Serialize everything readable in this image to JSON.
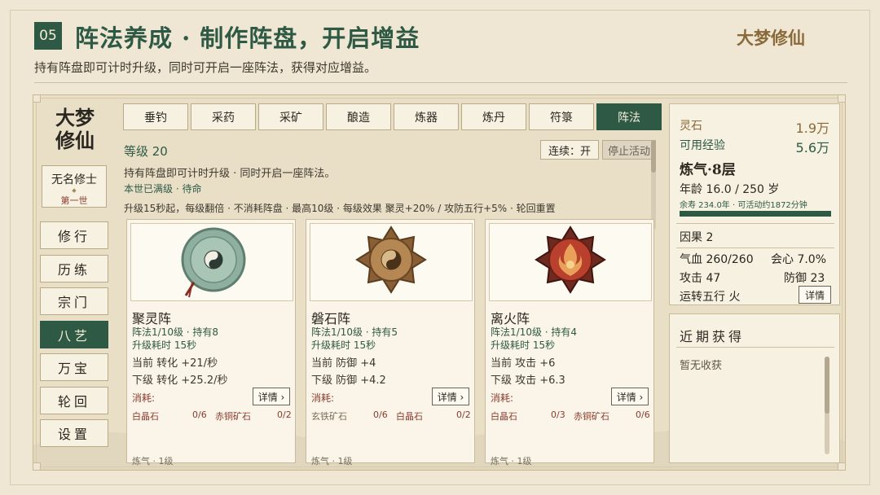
{
  "header": {
    "number": "05",
    "title": "阵法养成 · 制作阵盘，开启增益",
    "brand": "大梦修仙",
    "subtitle": "持有阵盘即可计时升级，同时可开启一座阵法，获得对应增益。"
  },
  "sidebar": {
    "logo_line1": "大梦",
    "logo_line2": "修仙",
    "player_name": "无名修士",
    "player_gen": "第一世",
    "items": [
      {
        "label": "修行"
      },
      {
        "label": "历练"
      },
      {
        "label": "宗门"
      },
      {
        "label": "八艺",
        "active": true
      },
      {
        "label": "万宝"
      },
      {
        "label": "轮回"
      },
      {
        "label": "设置"
      }
    ]
  },
  "tabs": [
    "垂钓",
    "采药",
    "采矿",
    "酿造",
    "炼器",
    "炼丹",
    "符箓",
    "阵法"
  ],
  "active_tab": "阵法",
  "main": {
    "level": "等级 20",
    "continuous": "连续：开",
    "stop": "停止活动",
    "desc": "持有阵盘即可计时升级 · 同时开启一座阵法。",
    "maxed": "本世已满级 · 待命",
    "rule": "升级15秒起，每级翻倍 · 不消耗阵盘 · 最高10级 · 每级效果 聚灵+20% / 攻防五行+5% · 轮回重置"
  },
  "cards": [
    {
      "name": "聚灵阵",
      "level": "阵法1/10级 · 持有8",
      "time": "升级耗时 15秒",
      "current": "当前 转化 +21/秒",
      "next": "下级 转化 +25.2/秒",
      "cost_label": "消耗:",
      "detail": "详情 ›",
      "mat1": "白晶石",
      "mat1_qty": "0/6",
      "mat2": "赤铜矿石",
      "mat2_qty": "0/2",
      "foot": "炼气 · 1级",
      "icon": "jade-disc-icon"
    },
    {
      "name": "磐石阵",
      "level": "阵法1/10级 · 持有5",
      "time": "升级耗时 15秒",
      "current": "当前 防御 +4",
      "next": "下级 防御 +4.2",
      "cost_label": "消耗:",
      "detail": "详情 ›",
      "mat1": "玄铁矿石",
      "mat1_qty": "0/6",
      "mat2": "白晶石",
      "mat2_qty": "0/2",
      "foot": "炼气 · 1级",
      "icon": "bronze-bagua-icon"
    },
    {
      "name": "离火阵",
      "level": "阵法1/10级 · 持有4",
      "time": "升级耗时 15秒",
      "current": "当前 攻击 +6",
      "next": "下级 攻击 +6.3",
      "cost_label": "消耗:",
      "detail": "详情 ›",
      "mat1": "白晶石",
      "mat1_qty": "0/3",
      "mat2": "赤铜矿石",
      "mat2_qty": "0/6",
      "foot": "炼气 · 1级",
      "icon": "fire-disc-icon"
    }
  ],
  "stats": {
    "stone_label": "灵石",
    "stone": "1.9万",
    "exp_label": "可用经验",
    "exp": "5.6万",
    "realm": "炼气·8层",
    "age": "年龄 16.0 / 250 岁",
    "life": "余寿 234.0年 · 可活动约1872分钟",
    "karma": "因果  2",
    "hp": "气血  260/260",
    "crit": "会心  7.0%",
    "atk": "攻击  47",
    "def": "防御  23",
    "element": "运转五行  火",
    "detail": "详情"
  },
  "recent": {
    "title": "近期获得",
    "empty": "暂无收获"
  },
  "colors": {
    "accent": "#2e5a45",
    "gold": "#8a6a3a",
    "cost": "#8a3b2e",
    "bg": "#efe7d3"
  }
}
